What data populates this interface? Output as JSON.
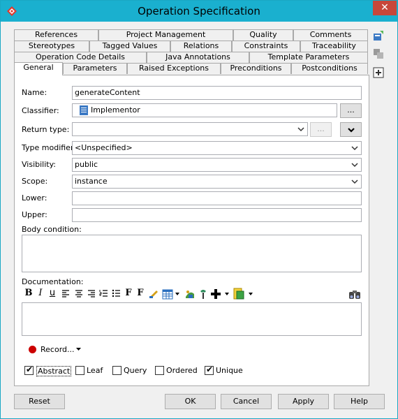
{
  "window": {
    "title": "Operation Specification",
    "close_glyph": "✕"
  },
  "tabs": {
    "row1": [
      "References",
      "Project Management",
      "Quality",
      "Comments"
    ],
    "row2": [
      "Stereotypes",
      "Tagged Values",
      "Relations",
      "Constraints",
      "Traceability"
    ],
    "row3": [
      "Operation Code Details",
      "Java Annotations",
      "Template Parameters"
    ],
    "row4": [
      "General",
      "Parameters",
      "Raised Exceptions",
      "Preconditions",
      "Postconditions"
    ],
    "active": "General"
  },
  "form": {
    "name_label": "Name:",
    "name_value": "generateContent",
    "classifier_label": "Classifier:",
    "classifier_value": "Implementor",
    "classifier_button": "...",
    "return_type_label": "Return type:",
    "return_type_value": "",
    "return_type_button": "...",
    "type_modifier_label": "Type modifier:",
    "type_modifier_value": "<Unspecified>",
    "visibility_label": "Visibility:",
    "visibility_value": "public",
    "scope_label": "Scope:",
    "scope_value": "instance",
    "lower_label": "Lower:",
    "lower_value": "",
    "upper_label": "Upper:",
    "upper_value": "",
    "body_condition_label": "Body condition:",
    "documentation_label": "Documentation:"
  },
  "doc_toolbar": {
    "bold": "B",
    "italic": "I",
    "underline": "u",
    "font": "F",
    "font_size": "F",
    "icons": [
      "bold-icon",
      "italic-icon",
      "underline-icon",
      "align-left-icon",
      "align-center-icon",
      "align-right-icon",
      "numbered-list-icon",
      "bullet-list-icon",
      "font-icon",
      "font-size-icon",
      "text-color-icon",
      "table-icon",
      "image-icon",
      "link-icon",
      "insert-icon",
      "attachment-icon",
      "find-icon"
    ]
  },
  "record": {
    "label": "Record..."
  },
  "checkboxes": [
    {
      "label": "Abstract",
      "checked": true
    },
    {
      "label": "Leaf",
      "checked": false
    },
    {
      "label": "Query",
      "checked": false
    },
    {
      "label": "Ordered",
      "checked": false
    },
    {
      "label": "Unique",
      "checked": true
    }
  ],
  "footer": {
    "reset": "Reset",
    "ok": "OK",
    "cancel": "Cancel",
    "apply": "Apply",
    "help": "Help"
  },
  "colors": {
    "titlebar": "#1ab0cf",
    "close": "#c7473a",
    "record": "#cc0000"
  }
}
